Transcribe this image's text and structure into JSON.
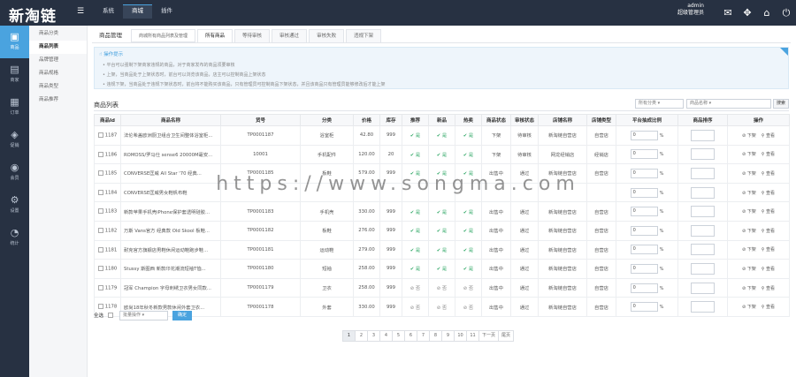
{
  "header": {
    "logo": "新淘链",
    "menu_icon": "hamburger-icon",
    "nav": [
      "系统",
      "商城",
      "插件"
    ],
    "user_name": "admin",
    "user_role": "超级管理员",
    "icons": [
      "message-icon",
      "expand-icon",
      "home-icon",
      "power-icon"
    ]
  },
  "rail": [
    {
      "label": "商品",
      "icon": "bag-icon"
    },
    {
      "label": "商家",
      "icon": "store-icon"
    },
    {
      "label": "订单",
      "icon": "order-icon"
    },
    {
      "label": "促销",
      "icon": "promo-icon"
    },
    {
      "label": "会员",
      "icon": "member-icon"
    },
    {
      "label": "设置",
      "icon": "setting-icon"
    },
    {
      "label": "统计",
      "icon": "chart-icon"
    }
  ],
  "subnav": [
    "商品分类",
    "商品列表",
    "品牌管理",
    "商品规格",
    "商品类型",
    "商品推荐"
  ],
  "tabs": {
    "caption": "商品管理",
    "tip": "商城所有商品列表及管理",
    "items": [
      "所有商品",
      "等待审核",
      "审核通过",
      "审核失败",
      "违规下架"
    ]
  },
  "notice": {
    "heading": "操作提示",
    "lines": [
      "平台可以强制下架商家违规的商品，对于商家发布的商品须要审核",
      "上架，当商品处于上架状态时，前台可以浏览该商品，店主可以控制商品上架状态",
      "违规下架，当商品处于违规下架状态时，前台将不能购买该商品，只有管理员可控制商品下架状态，并且该商品只有管理员能够修改后才能上架"
    ]
  },
  "list": {
    "title": "商品列表",
    "category_select": "所有分类",
    "keyword_select": "商品名称",
    "search_button": "搜索"
  },
  "table": {
    "headers": [
      "商品Id",
      "商品名称",
      "货号",
      "分类",
      "价格",
      "库存",
      "推荐",
      "新品",
      "热卖",
      "商品状态",
      "审核状态",
      "店铺名称",
      "店铺类型",
      "平台抽成比例",
      "商品排序",
      "操作"
    ],
    "rows": [
      {
        "id": "1187",
        "name": "法伦希盖欧洲厨卫组合卫生间整体浴室柜...",
        "sn": "TP0001187",
        "cat": "浴室柜",
        "price": "42.80",
        "stock": "999",
        "rec": "是",
        "new": "是",
        "hot": "是",
        "status": "下架",
        "audit": "待审核",
        "shop": "新淘链自营店",
        "stype": "自营店",
        "rate": "0"
      },
      {
        "id": "1186",
        "name": "ROMOSS/罗马仕 sense6 20000M毫安...",
        "sn": "10001",
        "cat": "手机配件",
        "price": "120.00",
        "stock": "20",
        "rec": "是",
        "new": "是",
        "hot": "是",
        "status": "下架",
        "audit": "待审核",
        "shop": "网龙经销店",
        "stype": "经销店",
        "rate": "0"
      },
      {
        "id": "1185",
        "name": "CONVERSE匡威 All Star '70 经典...",
        "sn": "TP0001185",
        "cat": "板鞋",
        "price": "579.00",
        "stock": "999",
        "rec": "是",
        "new": "是",
        "hot": "是",
        "status": "出售中",
        "audit": "通过",
        "shop": "新淘链自营店",
        "stype": "自营店",
        "rate": "0"
      },
      {
        "id": "1184",
        "name": "CONVERSE匡威男女鞋帆布鞋",
        "sn": "",
        "cat": "",
        "price": "",
        "stock": "",
        "rec": "",
        "new": "",
        "hot": "",
        "status": "",
        "audit": "",
        "shop": "",
        "stype": "",
        "rate": "0"
      },
      {
        "id": "1183",
        "name": "新款苹果手机壳iPhone保护套透明硅胶...",
        "sn": "TP0001183",
        "cat": "手机壳",
        "price": "330.00",
        "stock": "999",
        "rec": "是",
        "new": "是",
        "hot": "是",
        "status": "出售中",
        "audit": "通过",
        "shop": "新淘链自营店",
        "stype": "自营店",
        "rate": "0"
      },
      {
        "id": "1182",
        "name": "万斯 Vans官方 经典款 Old Skool 板鞋...",
        "sn": "TP0001182",
        "cat": "板鞋",
        "price": "276.00",
        "stock": "999",
        "rec": "是",
        "new": "是",
        "hot": "是",
        "status": "出售中",
        "audit": "通过",
        "shop": "新淘链自营店",
        "stype": "自营店",
        "rate": "0"
      },
      {
        "id": "1181",
        "name": "耐克官方旗舰店男鞋休闲运动鞋跑步鞋...",
        "sn": "TP0001181",
        "cat": "运动鞋",
        "price": "279.00",
        "stock": "999",
        "rec": "是",
        "new": "是",
        "hot": "是",
        "status": "出售中",
        "audit": "通过",
        "shop": "新淘链自营店",
        "stype": "自营店",
        "rate": "0"
      },
      {
        "id": "1180",
        "name": "Stussy 斯图西 新款印花潮流短袖T恤...",
        "sn": "TP0001180",
        "cat": "短袖",
        "price": "258.00",
        "stock": "999",
        "rec": "是",
        "new": "是",
        "hot": "是",
        "status": "出售中",
        "audit": "通过",
        "shop": "新淘链自营店",
        "stype": "自营店",
        "rate": "0"
      },
      {
        "id": "1179",
        "name": "冠军 Champion 字母刺绣卫衣男女同款...",
        "sn": "TP0001179",
        "cat": "卫衣",
        "price": "258.00",
        "stock": "999",
        "rec": "否",
        "new": "否",
        "hot": "否",
        "status": "出售中",
        "audit": "通过",
        "shop": "新淘链自营店",
        "stype": "自营店",
        "rate": "0"
      },
      {
        "id": "1178",
        "name": "欧尚18年秋冬新款男款休闲外套卫衣...",
        "sn": "TP0001178",
        "cat": "外套",
        "price": "330.00",
        "stock": "999",
        "rec": "否",
        "new": "否",
        "hot": "否",
        "status": "出售中",
        "audit": "通过",
        "shop": "新淘链自营店",
        "stype": "自营店",
        "rate": "0"
      }
    ],
    "percent": "%",
    "op_down": "下架",
    "op_view": "查看"
  },
  "bottom": {
    "select_all": "全选",
    "batch_select": "批量操作",
    "confirm": "确定"
  },
  "pager": [
    "1",
    "2",
    "3",
    "4",
    "5",
    "6",
    "7",
    "8",
    "9",
    "10",
    "11",
    "下一页",
    "尾页"
  ],
  "watermark": "https://www.songma.com"
}
